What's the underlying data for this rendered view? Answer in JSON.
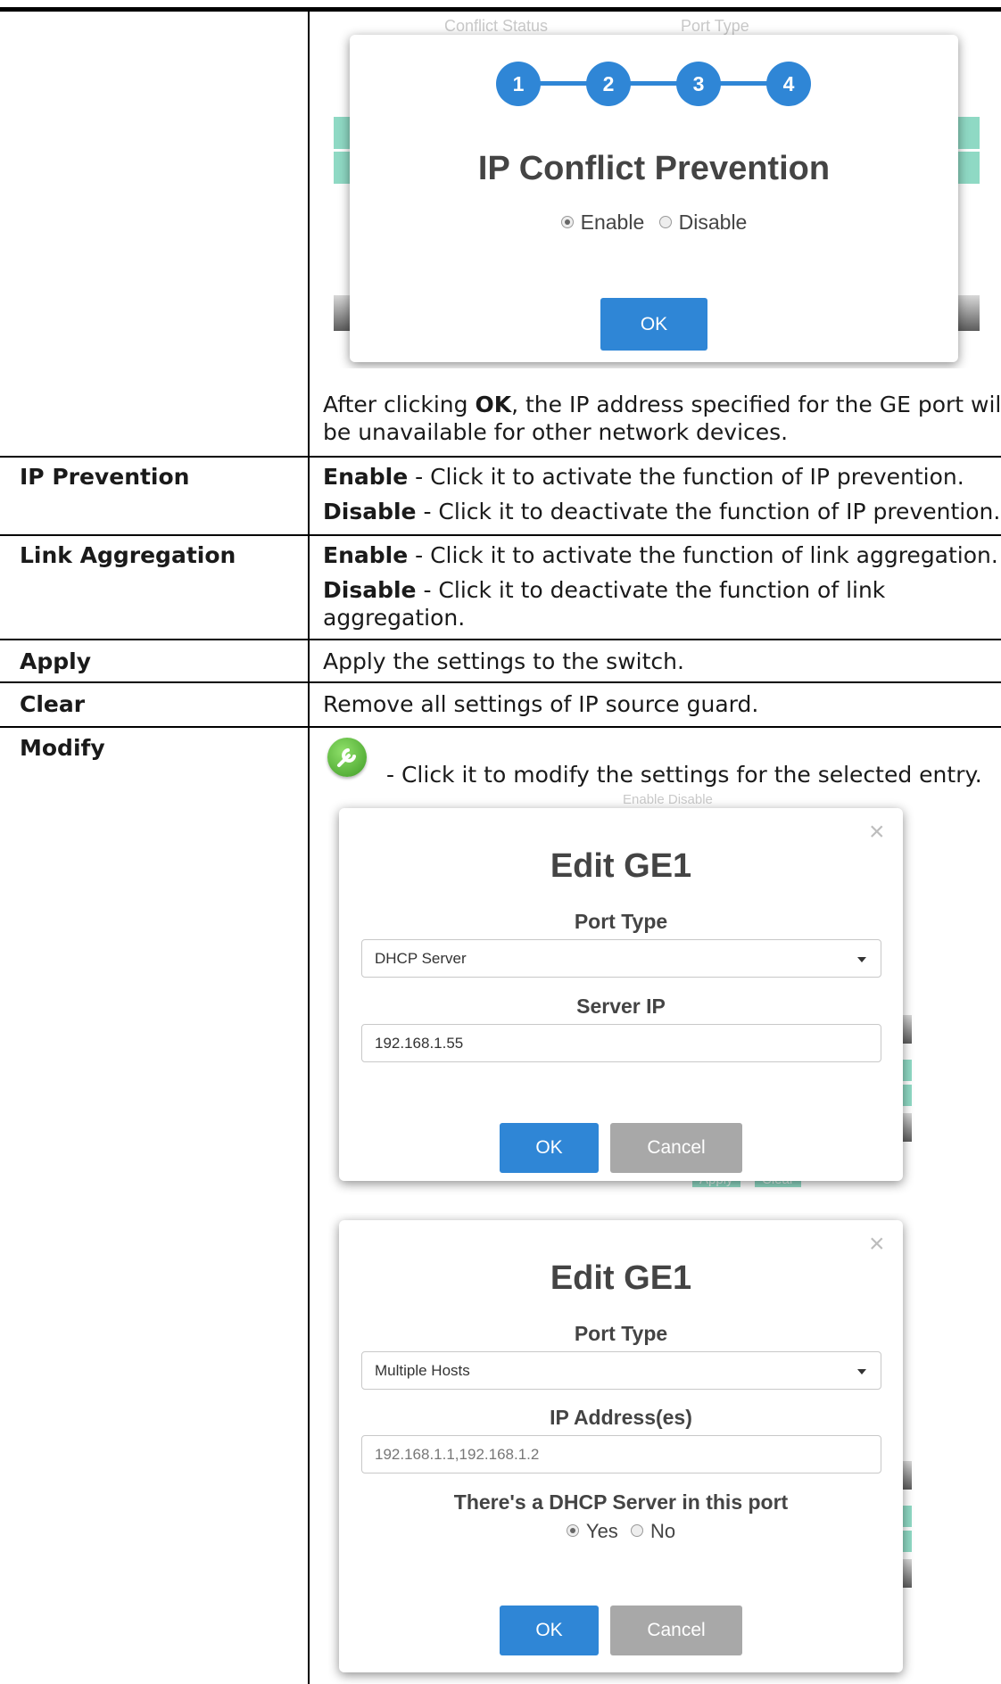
{
  "top_dialog": {
    "ghost_headers": [
      "Conflict Status",
      "Port Type"
    ],
    "steps": [
      "1",
      "2",
      "3",
      "4"
    ],
    "title": "IP Conflict Prevention",
    "enable_label": "Enable",
    "disable_label": "Disable",
    "ok_label": "OK"
  },
  "ok_note": {
    "prefix": "After clicking ",
    "ok_word": "OK",
    "line1_rest": ", the IP address specified for the GE port will",
    "line2": "be unavailable for other network devices."
  },
  "rows": {
    "ip_prevention": {
      "term": "IP Prevention",
      "enable_term": "Enable",
      "enable_text": " - Click it to activate the function of IP prevention.",
      "disable_term": "Disable",
      "disable_text": " - Click it to deactivate the function of IP prevention."
    },
    "link_aggregation": {
      "term": "Link Aggregation",
      "enable_term": "Enable",
      "enable_text": " - Click it to activate the function of link aggregation.",
      "disable_term": "Disable",
      "disable_text": " - Click it to deactivate the function of link",
      "disable_text2": "aggregation."
    },
    "apply": {
      "term": "Apply",
      "desc": "Apply the settings to the switch."
    },
    "clear": {
      "term": "Clear",
      "desc": "Remove all settings of IP source guard."
    },
    "modify": {
      "term": "Modify",
      "desc": "- Click it to modify the settings for the selected entry."
    }
  },
  "edit_dialog_1": {
    "ghost_text": "Enable   Disable",
    "ghost_bottom": [
      "Apply",
      "Clear"
    ],
    "title": "Edit GE1",
    "port_type_label": "Port Type",
    "port_type_value": "DHCP Server",
    "server_ip_label": "Server IP",
    "server_ip_value": "192.168.1.55",
    "ok_label": "OK",
    "cancel_label": "Cancel"
  },
  "edit_dialog_2": {
    "title": "Edit GE1",
    "port_type_label": "Port Type",
    "port_type_value": "Multiple Hosts",
    "ip_label": "IP Address(es)",
    "ip_value": "192.168.1.1,192.168.1.2",
    "dhcp_question": "There's a DHCP Server in this port",
    "yes_label": "Yes",
    "no_label": "No",
    "ok_label": "OK",
    "cancel_label": "Cancel"
  },
  "colors": {
    "accent_blue": "#2f86d6",
    "button_gray": "#a8a8a8",
    "modify_icon_green": "#5cb83a"
  }
}
